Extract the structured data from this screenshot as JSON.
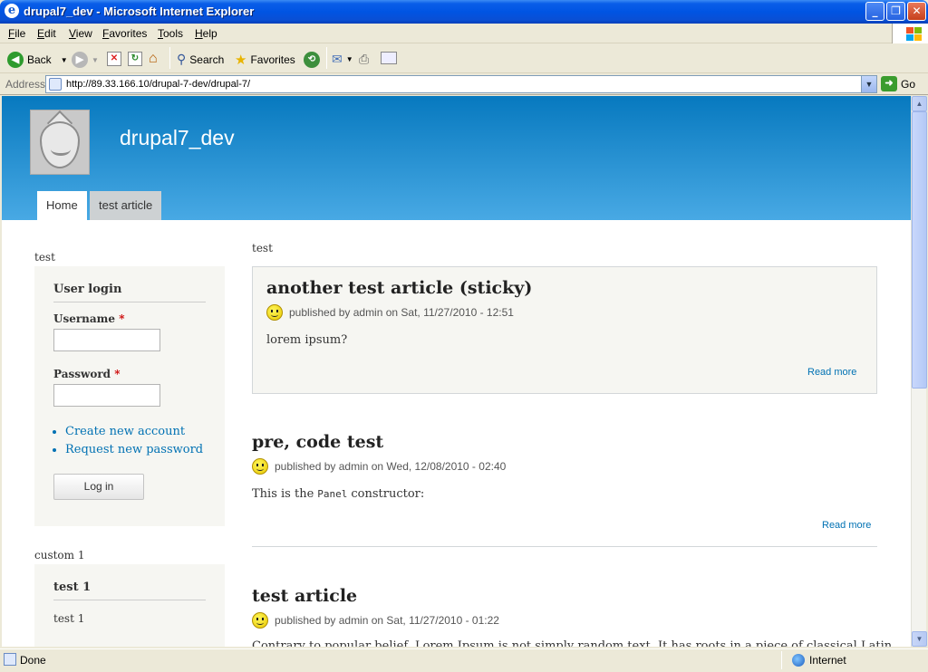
{
  "window": {
    "title": "drupal7_dev - Microsoft Internet Explorer",
    "controls": {
      "minimize": "_",
      "maximize": "❐",
      "close": "✕"
    }
  },
  "menu": [
    "File",
    "Edit",
    "View",
    "Favorites",
    "Tools",
    "Help"
  ],
  "toolbar": {
    "back": "Back",
    "search": "Search",
    "favorites": "Favorites"
  },
  "address": {
    "label": "Address",
    "url": "http://89.33.166.10/drupal-7-dev/drupal-7/",
    "go": "Go"
  },
  "site": {
    "name": "drupal7_dev",
    "tabs": [
      "Home",
      "test article"
    ]
  },
  "sidebar": {
    "region_label": "test",
    "login": {
      "title": "User login",
      "username_label": "Username",
      "password_label": "Password",
      "required_mark": "*",
      "links": [
        "Create new account",
        "Request new password"
      ],
      "button": "Log in"
    },
    "custom_label": "custom 1",
    "custom_block": {
      "title": "test 1",
      "body": "test 1"
    }
  },
  "main": {
    "region_label": "test",
    "nodes": [
      {
        "title": "another test article (sticky)",
        "meta": "published by admin on Sat, 11/27/2010 - 12:51",
        "body": "lorem ipsum?",
        "read_more": "Read more"
      },
      {
        "title": "pre, code test",
        "meta": "published by admin on Wed, 12/08/2010 - 02:40",
        "body_pre": "This is the",
        "body_code": "Panel",
        "body_post": "constructor:",
        "read_more": "Read more"
      },
      {
        "title": "test article",
        "meta": "published by admin on Sat, 11/27/2010 - 01:22",
        "body": "Contrary to popular belief, Lorem Ipsum is not simply random text. It has roots in a piece of classical Latin"
      }
    ]
  },
  "status": {
    "left": "Done",
    "zone": "Internet"
  }
}
